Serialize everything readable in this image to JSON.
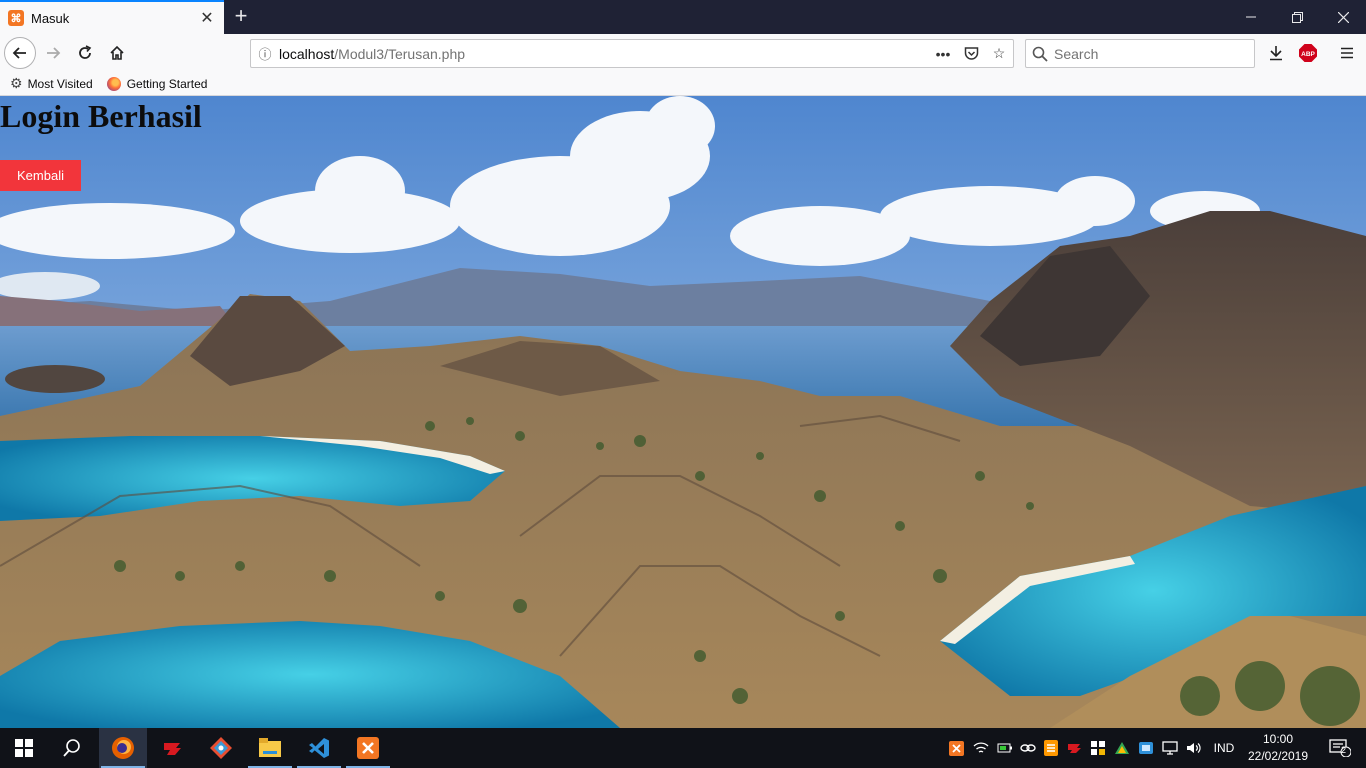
{
  "browser": {
    "tab_title": "Masuk",
    "url_host": "localhost",
    "url_path": "/Modul3/Terusan.php",
    "search_placeholder": "Search",
    "bookmarks": [
      "Most Visited",
      "Getting Started"
    ]
  },
  "page": {
    "heading": "Login Berhasil",
    "button_label": "Kembali",
    "button_color": "#f2353b"
  },
  "taskbar": {
    "language": "IND",
    "time": "10:00",
    "date": "22/02/2019",
    "notification_count": "2",
    "apps": [
      "start-icon",
      "search-icon",
      "firefox-icon",
      "garena-icon",
      "git-icon",
      "file-explorer-icon",
      "vscode-icon",
      "xampp-icon"
    ]
  }
}
